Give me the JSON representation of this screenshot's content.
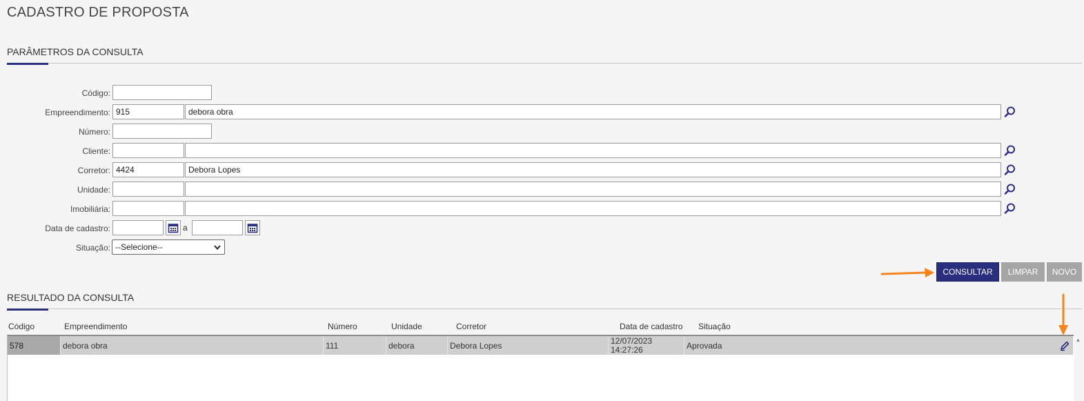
{
  "page_title": "CADASTRO DE PROPOSTA",
  "params_section_title": "PARÂMETROS DA CONSULTA",
  "results_section_title": "RESULTADO DA CONSULTA",
  "form": {
    "codigo": {
      "label": "Código:",
      "value": ""
    },
    "empreendimento": {
      "label": "Empreendimento:",
      "code": "915",
      "name": "debora obra"
    },
    "numero": {
      "label": "Número:",
      "value": ""
    },
    "cliente": {
      "label": "Cliente:",
      "code": "",
      "name": ""
    },
    "corretor": {
      "label": "Corretor:",
      "code": "4424",
      "name": "Debora Lopes"
    },
    "unidade": {
      "label": "Unidade:",
      "code": "",
      "name": ""
    },
    "imobiliaria": {
      "label": "Imobiliária:",
      "code": "",
      "name": ""
    },
    "data_cadastro": {
      "label": "Data de cadastro:",
      "from": "",
      "separator": "a",
      "to": ""
    },
    "situacao": {
      "label": "Situação:",
      "selected": "--Selecione--"
    }
  },
  "buttons": {
    "consultar": "CONSULTAR",
    "limpar": "LIMPAR",
    "novo": "NOVO"
  },
  "table": {
    "columns": [
      "Código",
      "Empreendimento",
      "Número",
      "Unidade",
      "Corretor",
      "Data de cadastro",
      "Situação"
    ],
    "rows": [
      {
        "codigo": "578",
        "empreendimento": "debora obra",
        "numero": "111",
        "unidade": "debora",
        "corretor": "Debora Lopes",
        "data_date": "12/07/2023",
        "data_time": "14:27:26",
        "situacao": "Aprovada"
      }
    ]
  },
  "icons": {
    "lookup": "magnifier-icon",
    "calendar": "calendar-icon",
    "edit": "pencil-icon",
    "annotation_arrow": "orange-arrow"
  },
  "colors": {
    "primary": "#2a2e7e",
    "secondary_button": "#a5a5a5",
    "selected_row": "#cfcfcf",
    "annotation": "#f5841f"
  }
}
